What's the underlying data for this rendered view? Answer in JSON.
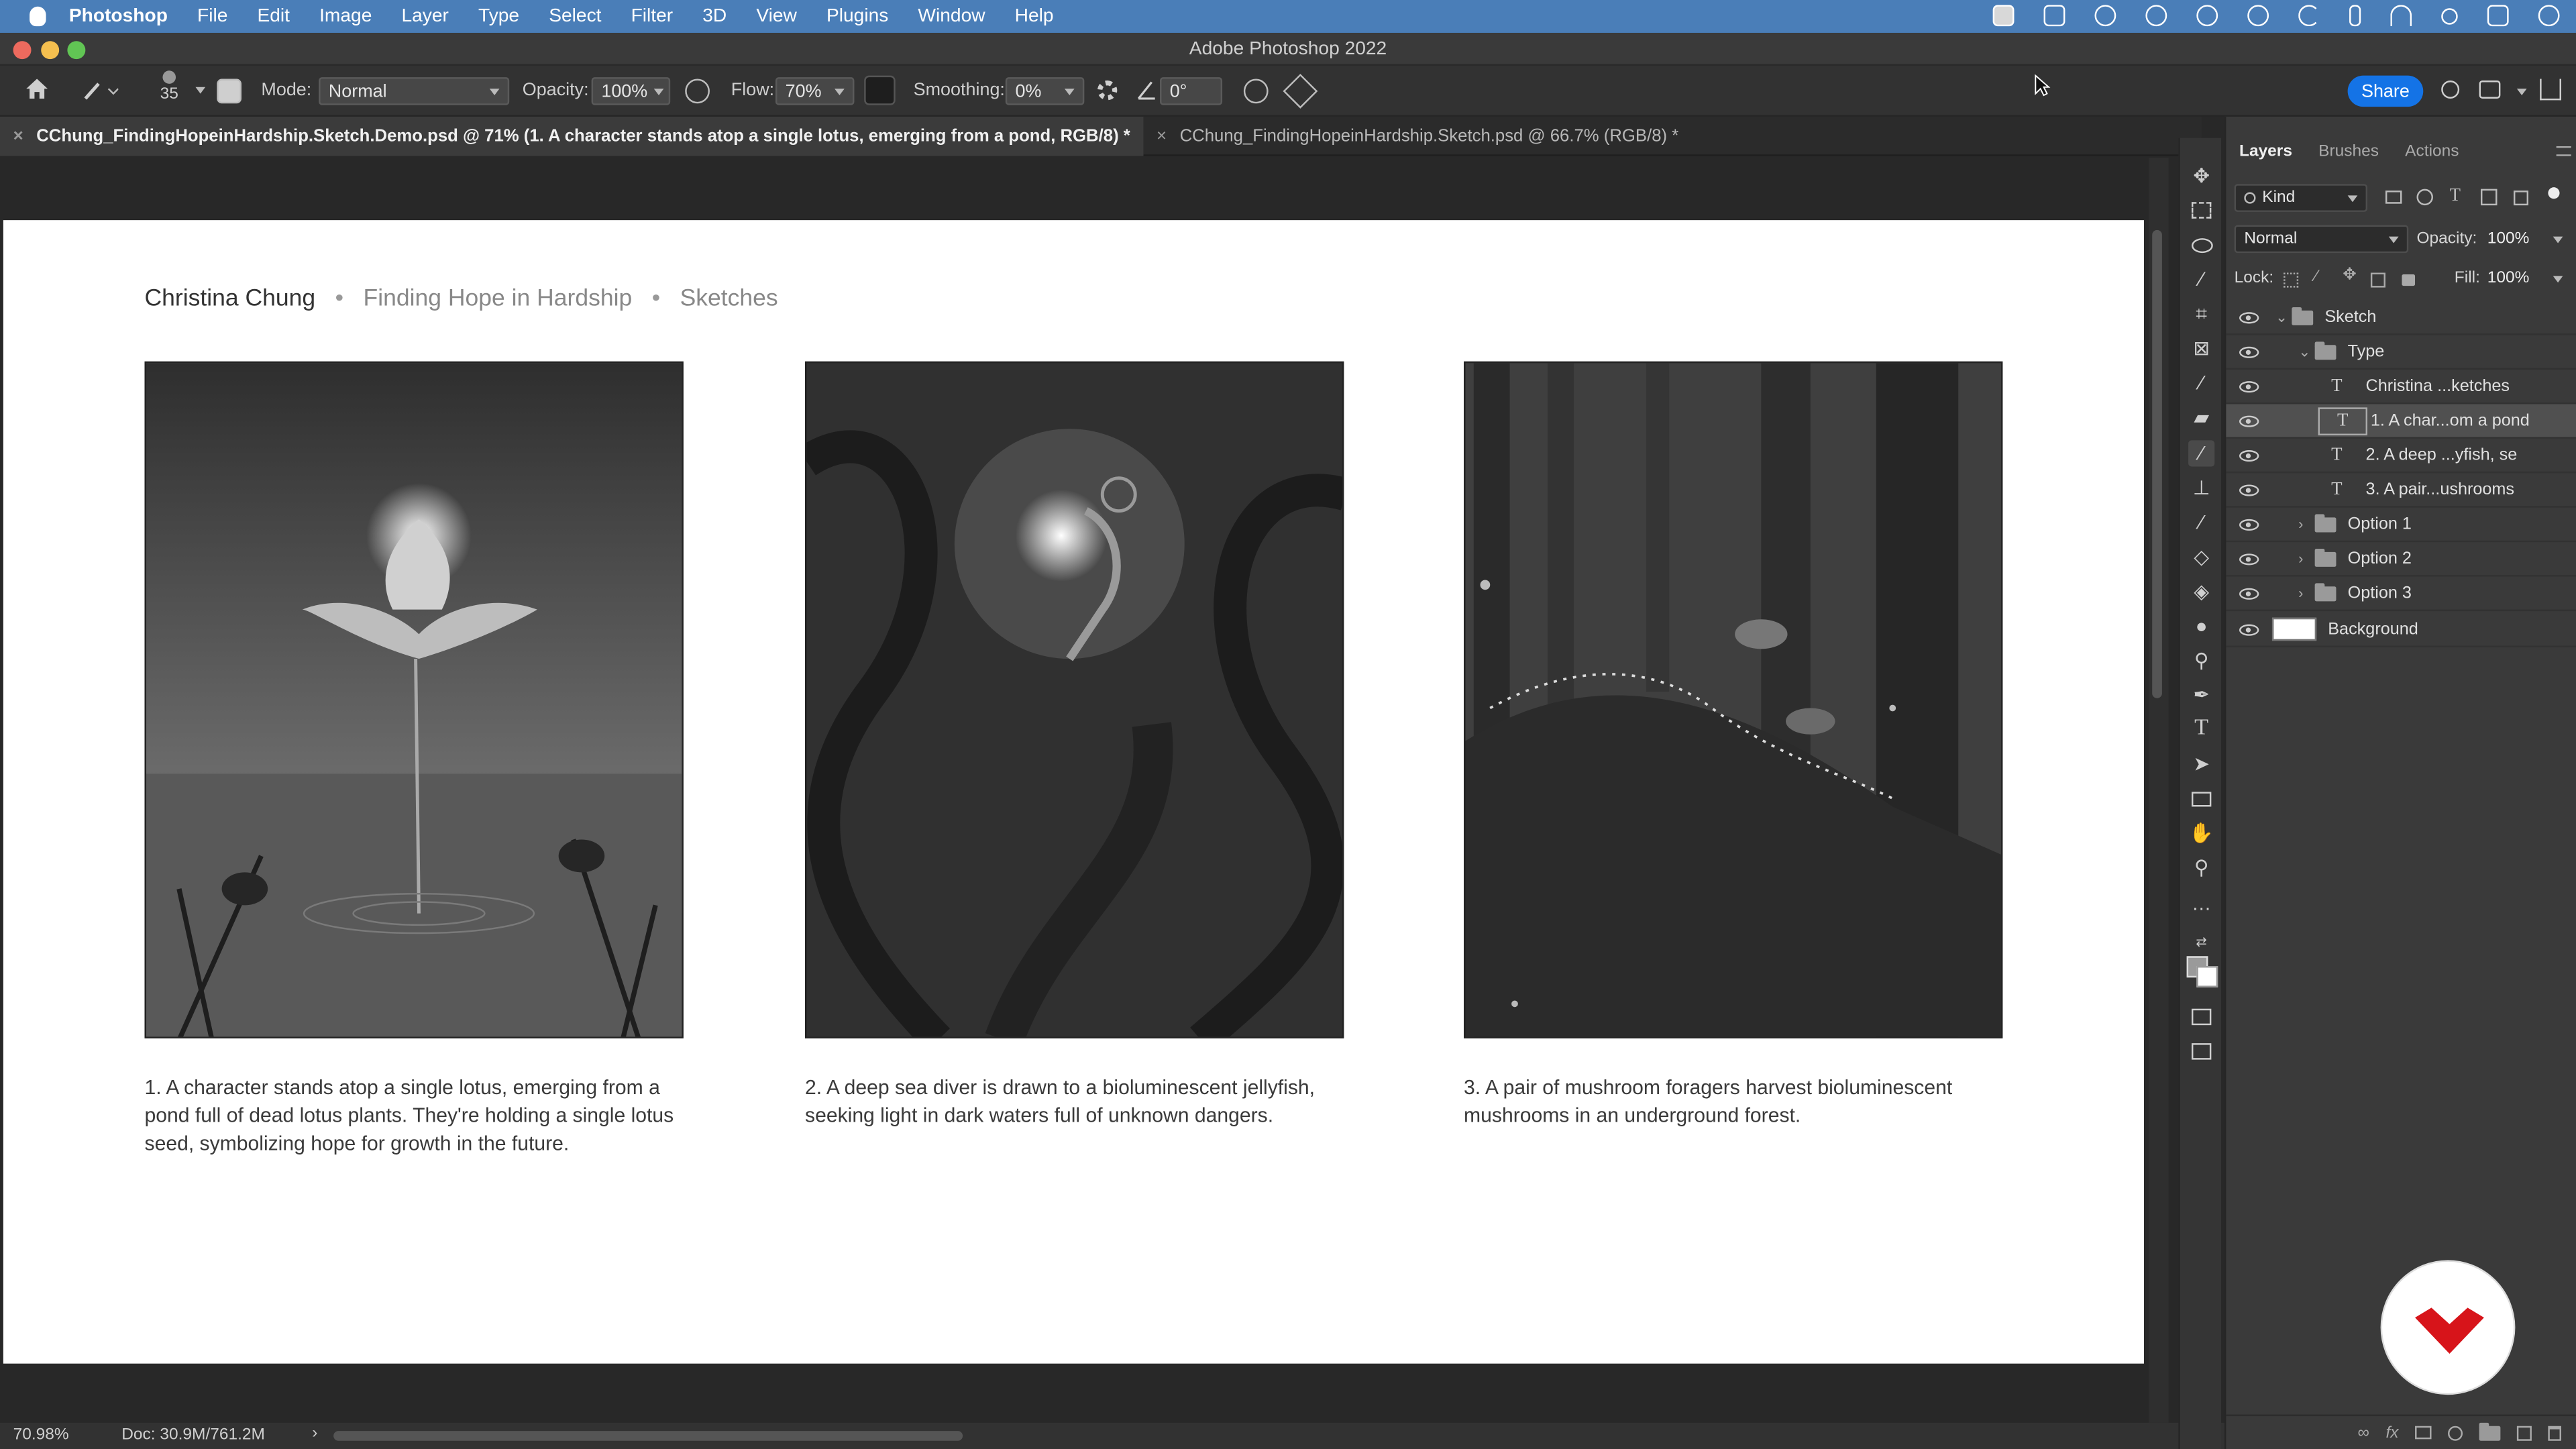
{
  "menubar": {
    "apple_icon": "apple-icon",
    "app_name": "Photoshop",
    "items": [
      "File",
      "Edit",
      "Image",
      "Layer",
      "Type",
      "Select",
      "Filter",
      "3D",
      "View",
      "Plugins",
      "Window",
      "Help"
    ]
  },
  "window": {
    "title": "Adobe Photoshop 2022"
  },
  "options": {
    "brush_size": "35",
    "mode_label": "Mode:",
    "mode_value": "Normal",
    "opacity_label": "Opacity:",
    "opacity_value": "100%",
    "flow_label": "Flow:",
    "flow_value": "70%",
    "smoothing_label": "Smoothing:",
    "smoothing_value": "0%",
    "angle_value": "0°",
    "share_label": "Share"
  },
  "tabs": [
    {
      "close": "×",
      "label": "CChung_FindingHopeinHardship.Sketch.Demo.psd @ 71% (1. A character stands atop a single lotus, emerging from a pond, RGB/8) *"
    },
    {
      "close": "×",
      "label": "CChung_FindingHopeinHardship.Sketch.psd @ 66.7% (RGB/8) *"
    }
  ],
  "document": {
    "header": {
      "author": "Christina Chung",
      "sep1": "•",
      "project": "Finding Hope in Hardship",
      "sep2": "•",
      "section": "Sketches"
    },
    "captions": [
      "1. A character stands atop a single lotus, emerging from a pond full of dead lotus plants. They're holding a single lotus seed, symbolizing hope for growth in the future.",
      "2. A deep sea diver is drawn to a bioluminescent jellyfish, seeking light in dark waters full of unknown dangers.",
      "3. A pair of mushroom foragers harvest bioluminescent mushrooms in an underground forest."
    ]
  },
  "status": {
    "zoom": "70.98%",
    "doc": "Doc: 30.9M/761.2M",
    "arrow": "›"
  },
  "layers_panel": {
    "tabs": [
      "Layers",
      "Brushes",
      "Actions"
    ],
    "filter_value": "Kind",
    "blend_mode": "Normal",
    "opacity_label": "Opacity:",
    "opacity_value": "100%",
    "lock_label": "Lock:",
    "fill_label": "Fill:",
    "fill_value": "100%",
    "layers": [
      {
        "name": "Sketch"
      },
      {
        "name": "Type"
      },
      {
        "name": "Christina ...ketches"
      },
      {
        "name": "1. A char...om a pond"
      },
      {
        "name": "2. A deep ...yfish, se"
      },
      {
        "name": "3. A pair...ushrooms"
      },
      {
        "name": "Option 1"
      },
      {
        "name": "Option 2"
      },
      {
        "name": "Option 3"
      },
      {
        "name": "Background"
      }
    ],
    "type_glyph": "T",
    "collapse_glyph": "⌄",
    "expand_glyph": "›"
  },
  "colors": {
    "menubar": "#4a7eb8",
    "share": "#1473e6",
    "logo": "#d7141a"
  }
}
